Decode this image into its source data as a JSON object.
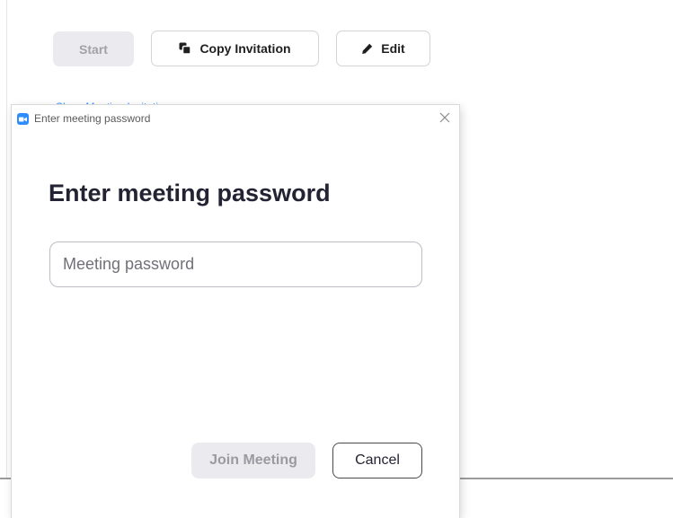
{
  "main_window": {
    "start_label": "Start",
    "copy_invitation_label": "Copy Invitation",
    "edit_label": "Edit",
    "link_text": "Show Meeting Invitation"
  },
  "dialog": {
    "window_title": "Enter meeting password",
    "heading": "Enter meeting password",
    "password_placeholder": "Meeting password",
    "password_value": "",
    "join_label": "Join Meeting",
    "cancel_label": "Cancel"
  },
  "colors": {
    "accent": "#2d8cff",
    "disabled_bg": "#ebebef",
    "heading_text": "#232333"
  },
  "icons": {
    "copy": "copy-icon",
    "edit": "pencil-icon",
    "app": "zoom-camera-icon",
    "close": "close-icon"
  }
}
